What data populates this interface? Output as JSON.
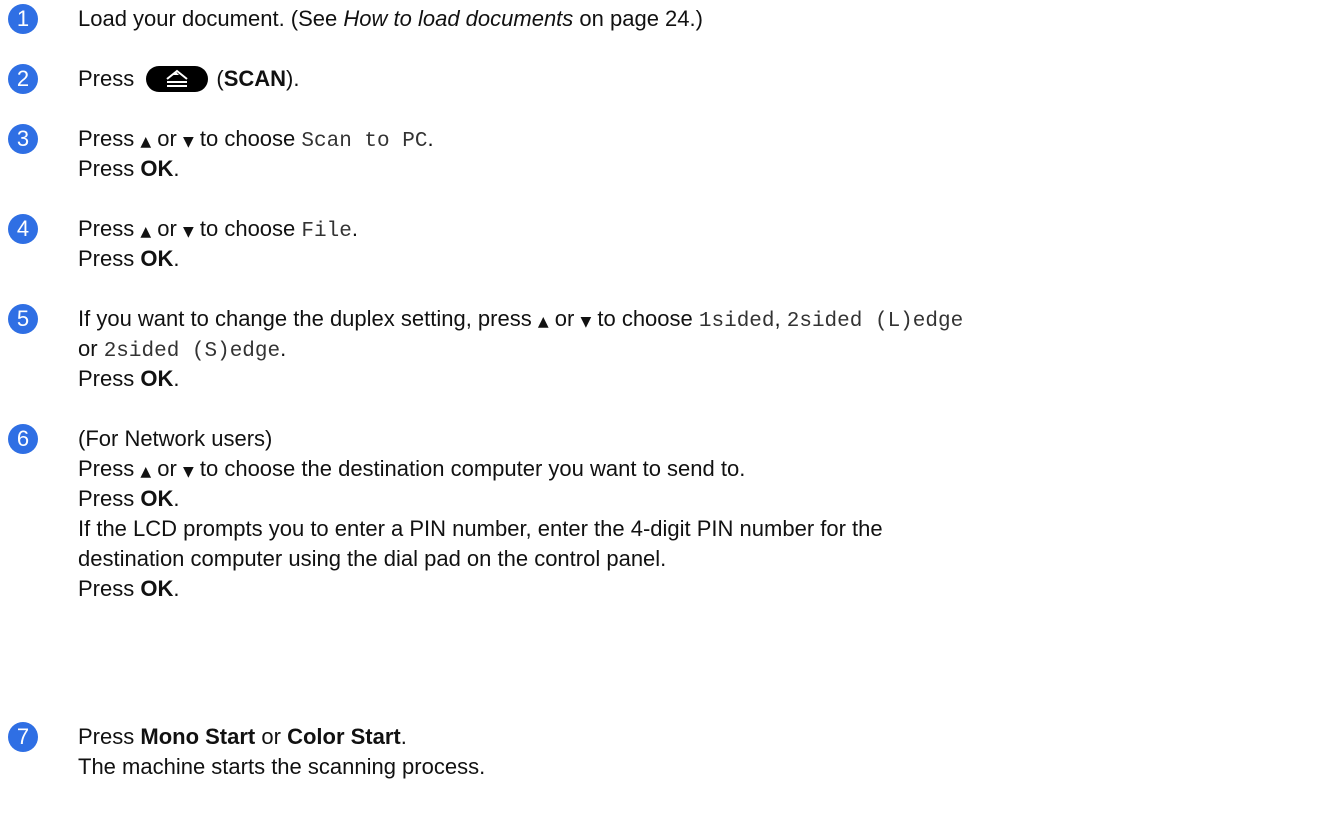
{
  "steps": [
    {
      "number": "1",
      "text_a": "Load your document. (See ",
      "link": "How to load documents",
      "text_b": " on page 24.)"
    },
    {
      "number": "2",
      "text_a": "Press",
      "paren_open": "(",
      "bold": "SCAN",
      "paren_close": ")."
    },
    {
      "number": "3",
      "press": "Press",
      "or": "or",
      "to_choose": "to choose",
      "option": "Scan to PC",
      "press_ok_a": "Press",
      "ok": "OK"
    },
    {
      "number": "4",
      "press": "Press",
      "or": "or",
      "to_choose": "to choose",
      "option": "File",
      "press_ok_a": "Press",
      "ok": "OK"
    },
    {
      "number": "5",
      "text_a": "If you want to change the duplex setting, press",
      "or": "or",
      "to_choose": "to choose",
      "opt1": "1sided",
      "opt2": "2sided (L)edge",
      "or2": "or",
      "opt3": "2sided (S)edge",
      "press_ok_a": "Press",
      "ok": "OK"
    },
    {
      "number": "6",
      "line1": "(For Network users)",
      "press": "Press",
      "or": "or",
      "line2_rest": "to choose the destination computer you want to send to.",
      "press_ok_a": "Press",
      "ok": "OK",
      "line4": "If the LCD prompts you to enter a PIN number, enter the 4-digit PIN number for the",
      "line5": "destination computer using the dial pad on the control panel.",
      "press_ok_b": "Press",
      "ok2": "OK"
    },
    {
      "number": "7",
      "press": "Press",
      "mono": "Mono Start",
      "or": "or",
      "color": "Color Start",
      "line2": "The machine starts the scanning process."
    }
  ],
  "colors": {
    "accent": "#2f6fe4"
  },
  "icons": {
    "up": "triangle-up-icon",
    "down": "triangle-down-icon",
    "scan": "scan-button-icon"
  }
}
